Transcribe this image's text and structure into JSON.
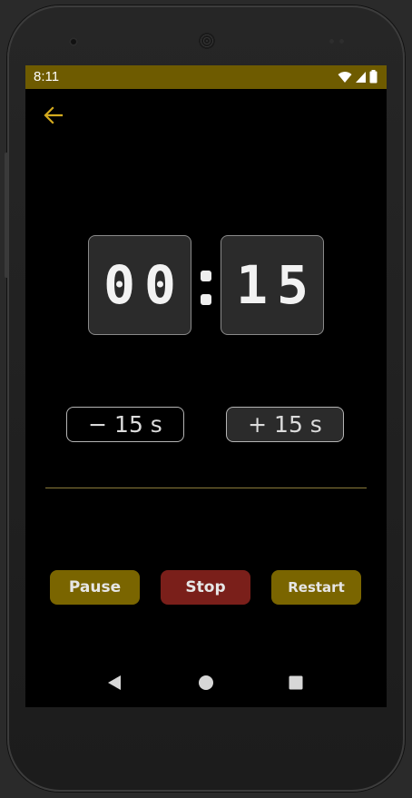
{
  "status_bar": {
    "time": "8:11",
    "icons": [
      "wifi-icon",
      "cell-signal-icon",
      "battery-icon"
    ],
    "color": "#6e5b00"
  },
  "toolbar": {
    "back_icon": "arrow-left-icon",
    "accent": "#d4aa1e"
  },
  "timer": {
    "minutes": "00",
    "seconds": "15",
    "separator": ":"
  },
  "adjust": {
    "minus_label": "− 15 s",
    "plus_label": "+ 15 s"
  },
  "actions": {
    "pause_label": "Pause",
    "stop_label": "Stop",
    "restart_label": "Restart",
    "pause_color": "#7a6500",
    "stop_color": "#7a1f1a",
    "restart_color": "#7a6500"
  },
  "navigation": {
    "items": [
      "back-triangle-icon",
      "home-circle-icon",
      "recents-square-icon"
    ]
  }
}
